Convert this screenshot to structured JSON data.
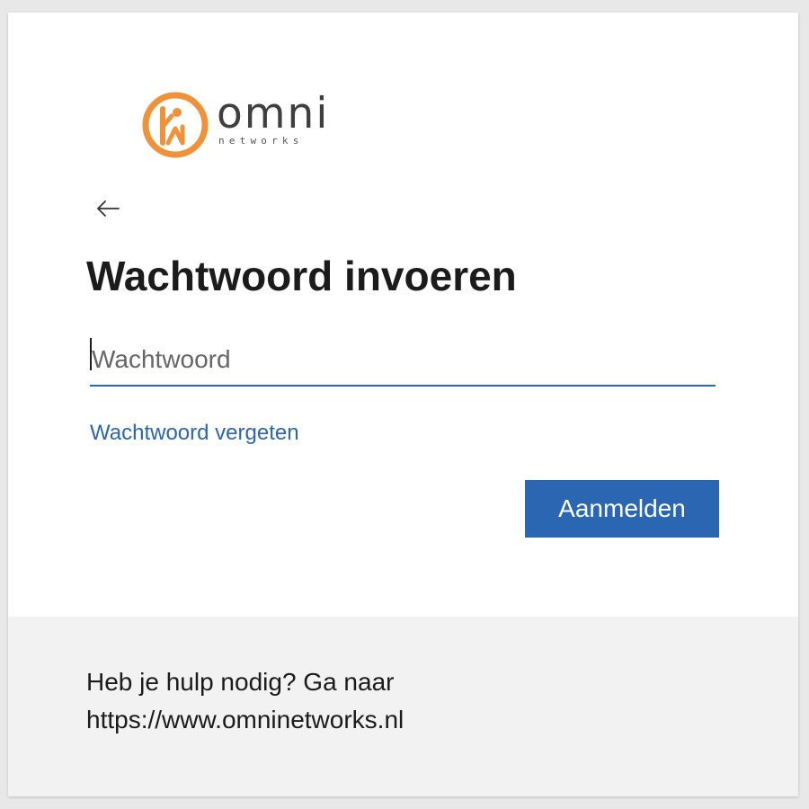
{
  "logo": {
    "word": "omni",
    "sub": "networks",
    "accent_color": "#f0923a"
  },
  "back_button": {
    "icon": "arrow-left-icon"
  },
  "identity": "",
  "title": "Wachtwoord invoeren",
  "password_field": {
    "placeholder": "Wachtwoord",
    "value": ""
  },
  "forgot_link": "Wachtwoord vergeten",
  "sign_in_button": "Aanmelden",
  "help": {
    "line1": "Heb je hulp nodig? Ga naar",
    "line2": "https://www.omninetworks.nl"
  },
  "colors": {
    "primary": "#2b66b2",
    "footer_bg": "#f2f2f2",
    "text": "#1b1b1b"
  }
}
